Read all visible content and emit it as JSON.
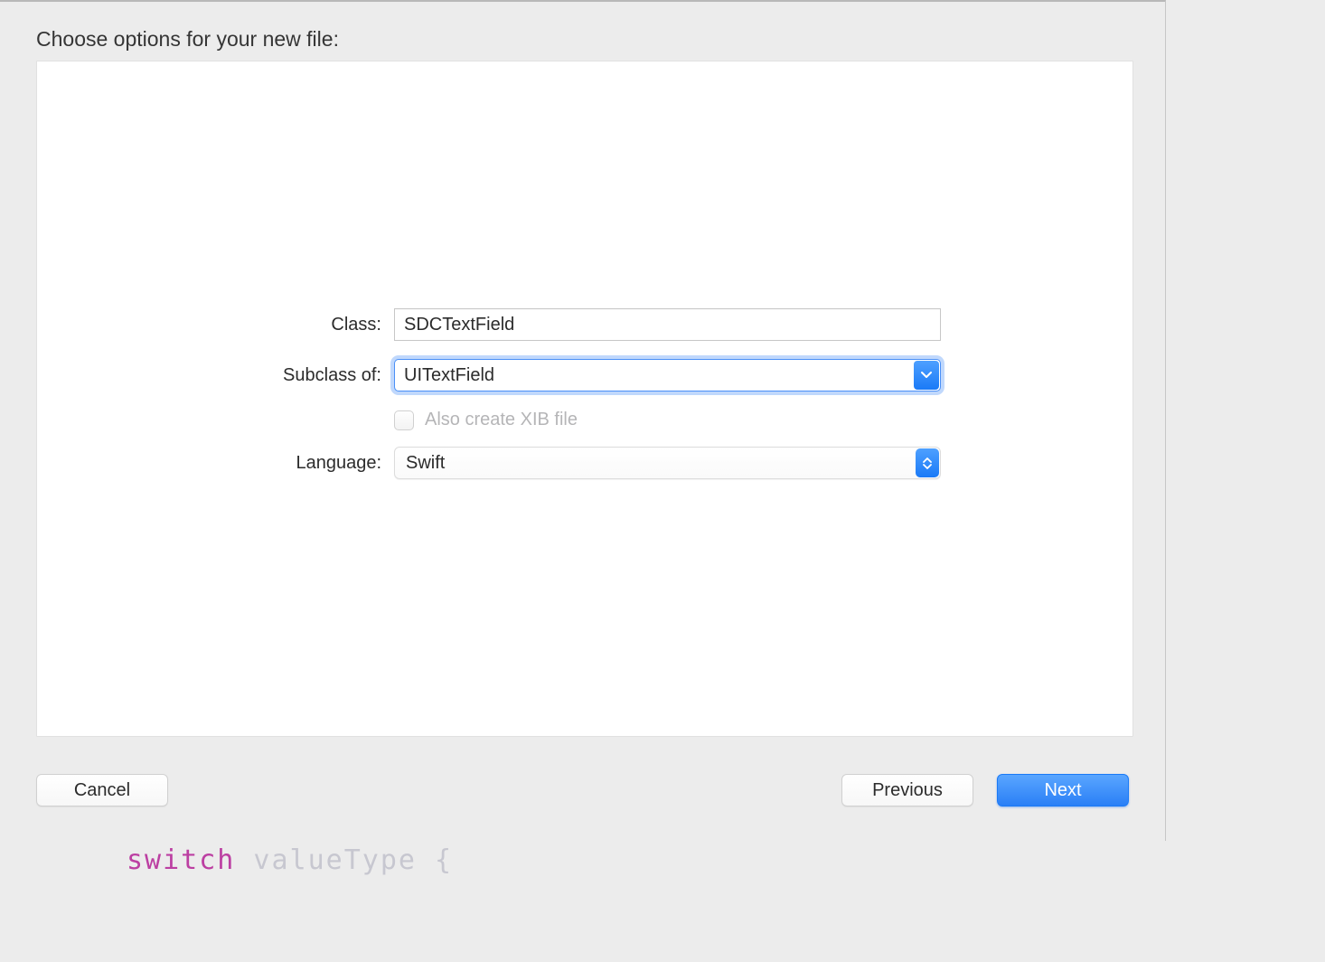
{
  "heading": "Choose options for your new file:",
  "form": {
    "class_label": "Class:",
    "class_value": "SDCTextField",
    "subclass_label": "Subclass of:",
    "subclass_value": "UITextField",
    "xib_label": "Also create XIB file",
    "language_label": "Language:",
    "language_value": "Swift"
  },
  "buttons": {
    "cancel": "Cancel",
    "previous": "Previous",
    "next": "Next"
  },
  "behind": {
    "keyword": "switch",
    "rest": " valueType {"
  }
}
